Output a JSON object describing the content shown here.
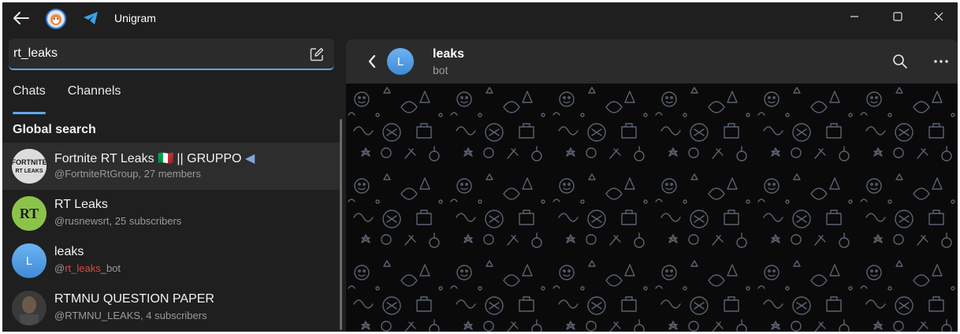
{
  "window": {
    "app_title": "Unigram",
    "controls": {
      "minimize": "–",
      "maximize": "☐",
      "close": "✕"
    }
  },
  "search": {
    "value": "rt_leaks",
    "placeholder": ""
  },
  "tabs": [
    {
      "label": "Chats",
      "active": true
    },
    {
      "label": "Channels",
      "active": false
    }
  ],
  "section_title": "Global search",
  "results": [
    {
      "title": "Fortnite RT Leaks 🇮🇹 || GRUPPO",
      "title_suffix_icon": "megaphone-icon",
      "subtitle": "@FortniteRtGroup, 27 members",
      "avatar_icon": "fortnite-logo-avatar",
      "selected": true
    },
    {
      "title": "RT Leaks",
      "subtitle": "@rusnewsrt, 25 subscribers",
      "avatar_icon": "rt-logo-avatar",
      "avatar_text": "RT",
      "selected": false
    },
    {
      "title": "leaks",
      "subtitle_prefix": "@",
      "subtitle_highlight": "rt_leaks",
      "subtitle_suffix": "_bot",
      "avatar_letter": "L",
      "selected": false
    },
    {
      "title": "RTMNU QUESTION PAPER",
      "subtitle": "@RTMNU_LEAKS, 4 subscribers",
      "avatar_icon": "person-photo-avatar",
      "selected": false
    }
  ],
  "chat": {
    "title": "leaks",
    "subtitle": "bot",
    "avatar_letter": "L"
  },
  "colors": {
    "accent": "#5fa8e6",
    "highlight": "#e04545",
    "background": "#1f1f1f",
    "wallpaper": "#0a0a0a",
    "doodle": "#5a6272"
  }
}
